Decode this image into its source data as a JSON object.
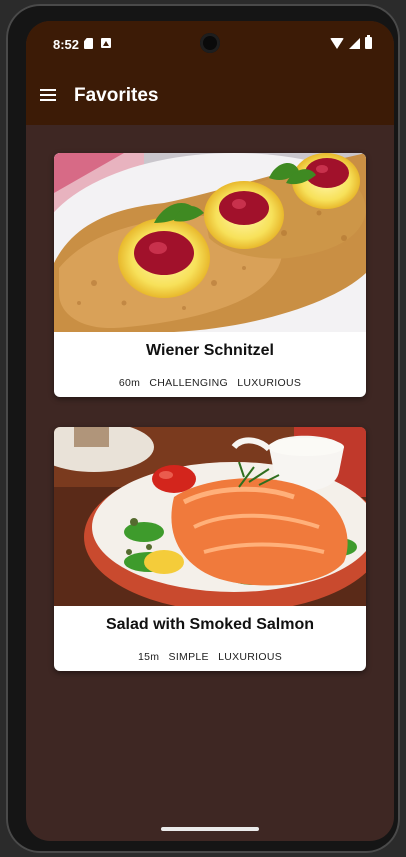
{
  "status_bar": {
    "time": "8:52",
    "icons": [
      "sim-card-icon",
      "photo-icon",
      "wifi-icon",
      "signal-icon",
      "battery-icon"
    ]
  },
  "app_bar": {
    "title": "Favorites",
    "menu_icon": "hamburger-menu-icon",
    "background": "#3c1b06"
  },
  "screen_background": "#3e2723",
  "meals": [
    {
      "title": "Wiener Schnitzel",
      "duration": "60m",
      "complexity": "CHALLENGING",
      "affordability": "LUXURIOUS",
      "image": "schnitzel-photo"
    },
    {
      "title": "Salad with Smoked Salmon",
      "duration": "15m",
      "complexity": "SIMPLE",
      "affordability": "LUXURIOUS",
      "image": "smoked-salmon-salad-photo"
    }
  ]
}
